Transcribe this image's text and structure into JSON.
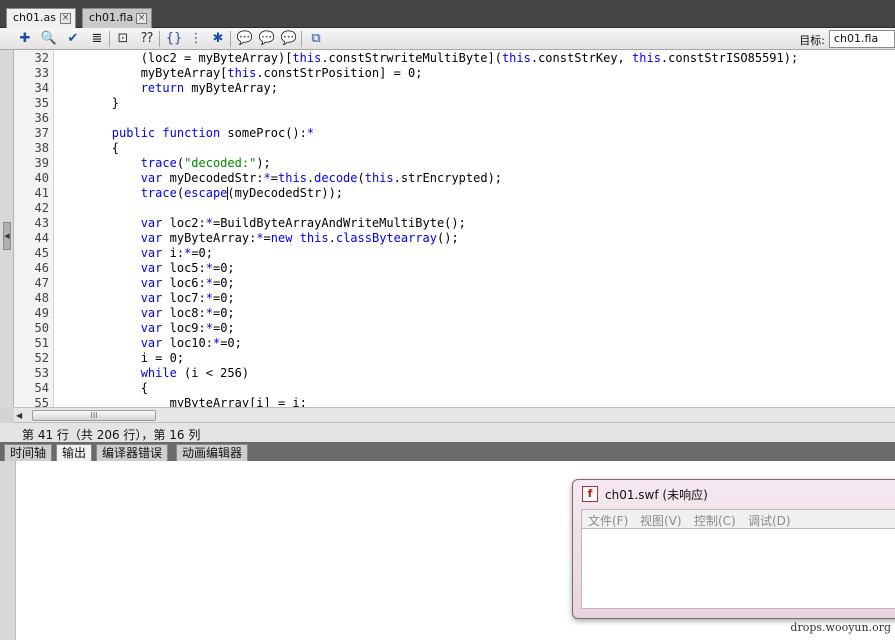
{
  "tabs": [
    {
      "label": "ch01.as",
      "active": true
    },
    {
      "label": "ch01.fla",
      "active": false
    }
  ],
  "toolbar": {
    "icons": [
      "add-statement-icon",
      "find-icon",
      "check-syntax-icon",
      "auto-format-icon",
      "code-hint-icon",
      "debug-options-icon",
      "collapse-between-braces-icon",
      "collapse-selection-icon",
      "expand-all-icon",
      "apply-block-comment-icon",
      "apply-line-comment-icon",
      "remove-comment-icon",
      "toggle-toolbox-icon"
    ],
    "target_label": "目标:",
    "target_value": "ch01.fla"
  },
  "code_lines": [
    {
      "num": "32",
      "text": "            (loc2 = myByteArray)[this.constStrwriteMultiByte](this.constStrKey, this.constStrISO85591);"
    },
    {
      "num": "33",
      "text": "            myByteArray[this.constStrPosition] = 0;"
    },
    {
      "num": "34",
      "text": "            return myByteArray;"
    },
    {
      "num": "35",
      "text": "        }"
    },
    {
      "num": "36",
      "text": ""
    },
    {
      "num": "37",
      "text": "        public function someProc():*"
    },
    {
      "num": "38",
      "text": "        {"
    },
    {
      "num": "39",
      "text": "            trace(\"decoded:\");"
    },
    {
      "num": "40",
      "text": "            var myDecodedStr:*=this.decode(this.strEncrypted);"
    },
    {
      "num": "41",
      "text": "            trace(escape(myDecodedStr));"
    },
    {
      "num": "42",
      "text": ""
    },
    {
      "num": "43",
      "text": "            var loc2:*=BuildByteArrayAndWriteMultiByte();"
    },
    {
      "num": "44",
      "text": "            var myByteArray:*=new this.classBytearray();"
    },
    {
      "num": "45",
      "text": "            var i:*=0;"
    },
    {
      "num": "46",
      "text": "            var loc5:*=0;"
    },
    {
      "num": "47",
      "text": "            var loc6:*=0;"
    },
    {
      "num": "48",
      "text": "            var loc7:*=0;"
    },
    {
      "num": "49",
      "text": "            var loc8:*=0;"
    },
    {
      "num": "50",
      "text": "            var loc9:*=0;"
    },
    {
      "num": "51",
      "text": "            var loc10:*=0;"
    },
    {
      "num": "52",
      "text": "            i = 0;"
    },
    {
      "num": "53",
      "text": "            while (i < 256)"
    },
    {
      "num": "54",
      "text": "            {"
    },
    {
      "num": "55",
      "text": "                myByteArray[i] = i;"
    }
  ],
  "scrollbar": {
    "grip": "III"
  },
  "status": {
    "text": "第 41 行（共 206 行），第 16 列"
  },
  "panel_tabs": [
    {
      "label": "时间轴",
      "active": false
    },
    {
      "label": "输出",
      "active": true
    },
    {
      "label": "编译器错误",
      "active": false
    },
    {
      "label": "动画编辑器",
      "active": false
    }
  ],
  "swf_window": {
    "title": "ch01.swf (未响应)",
    "menu": [
      "文件(F)",
      "视图(V)",
      "控制(C)",
      "调试(D)"
    ]
  },
  "watermark": "drops.wooyun.org",
  "colors": {
    "keyword": "#0000ff",
    "string": "#008800",
    "tab_bg": "#454545"
  }
}
